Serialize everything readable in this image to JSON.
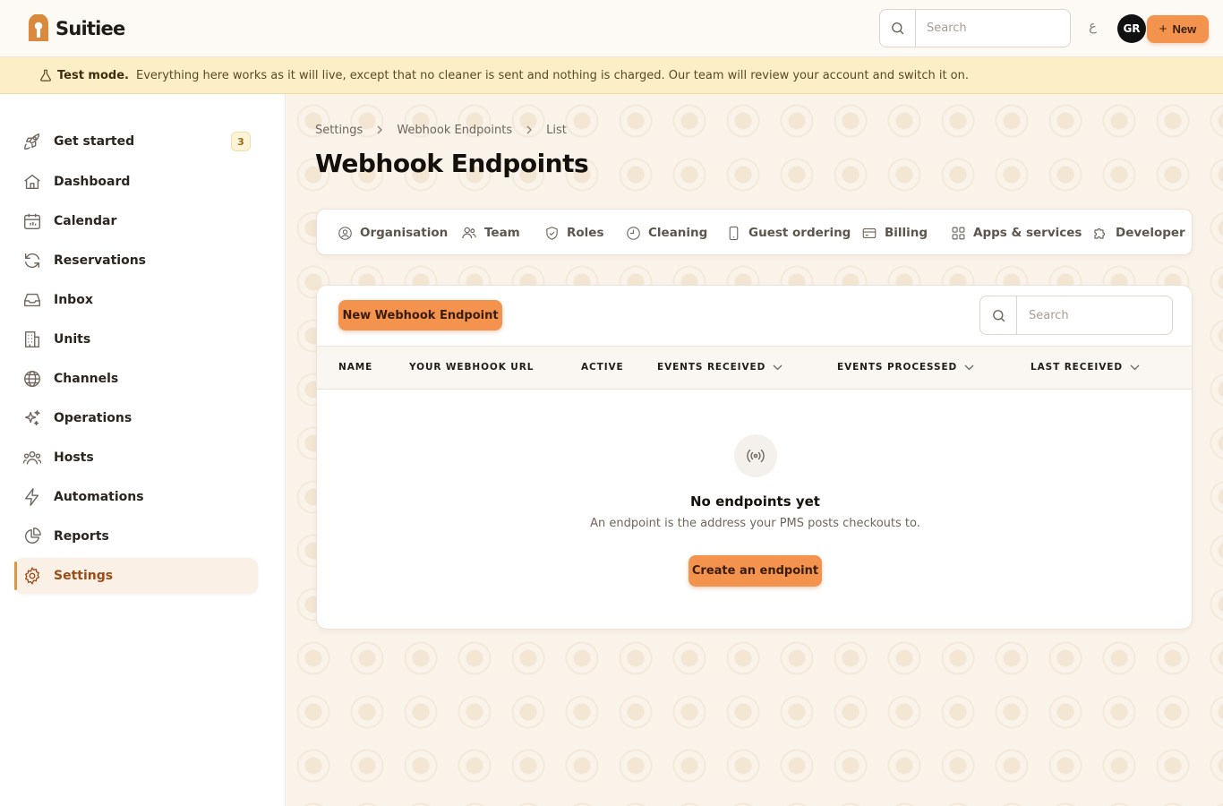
{
  "app": {
    "name": "Suitiee",
    "search_placeholder": "Search",
    "language_glyph": "ع",
    "avatar_initials": "GR",
    "new_label": "New"
  },
  "banner": {
    "title": "Test mode.",
    "message": "Everything here works as it will live, except that no cleaner is sent and nothing is charged. Our team will review your account and switch it on."
  },
  "sidebar": {
    "items": [
      {
        "label": "Get started",
        "icon": "rocket-icon",
        "badge": "3"
      },
      {
        "label": "Dashboard",
        "icon": "home-icon"
      },
      {
        "label": "Calendar",
        "icon": "calendar-icon"
      },
      {
        "label": "Reservations",
        "icon": "refresh-icon"
      },
      {
        "label": "Inbox",
        "icon": "inbox-icon"
      },
      {
        "label": "Units",
        "icon": "building-icon"
      },
      {
        "label": "Channels",
        "icon": "globe-icon"
      },
      {
        "label": "Operations",
        "icon": "sparkles-icon"
      },
      {
        "label": "Hosts",
        "icon": "users-icon"
      },
      {
        "label": "Automations",
        "icon": "bolt-icon"
      },
      {
        "label": "Reports",
        "icon": "pie-chart-icon"
      },
      {
        "label": "Settings",
        "icon": "gear-icon",
        "active": true
      }
    ]
  },
  "breadcrumb": [
    "Settings",
    "Webhook Endpoints",
    "List"
  ],
  "page_title": "Webhook Endpoints",
  "tabs": [
    {
      "label": "Organisation",
      "icon": "user-circle-icon"
    },
    {
      "label": "Team",
      "icon": "users-icon"
    },
    {
      "label": "Roles",
      "icon": "shield-icon"
    },
    {
      "label": "Cleaning",
      "icon": "clock-icon"
    },
    {
      "label": "Guest ordering",
      "icon": "phone-icon"
    },
    {
      "label": "Billing",
      "icon": "credit-card-icon"
    },
    {
      "label": "Apps & services",
      "icon": "grid-icon"
    },
    {
      "label": "Developer",
      "icon": "puzzle-icon"
    }
  ],
  "table": {
    "new_button": "New Webhook Endpoint",
    "search_placeholder": "Search",
    "columns": [
      "NAME",
      "YOUR WEBHOOK URL",
      "ACTIVE",
      "EVENTS RECEIVED",
      "EVENTS PROCESSED",
      "LAST RECEIVED"
    ],
    "rows": []
  },
  "empty_state": {
    "icon": "broadcast-icon",
    "title": "No endpoints yet",
    "subtitle": "An endpoint is the address your PMS posts checkouts to.",
    "button": "Create an endpoint"
  }
}
